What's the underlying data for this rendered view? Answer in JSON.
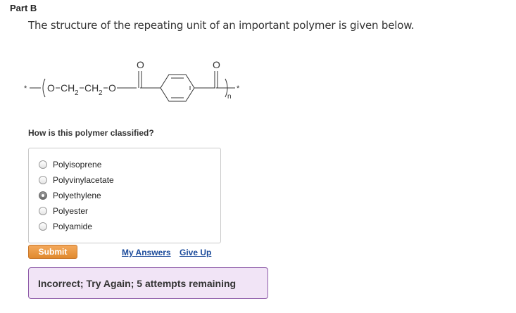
{
  "part": {
    "title": "Part B"
  },
  "intro": {
    "text": "The structure of the repeating unit of an important polymer is given below."
  },
  "structure": {
    "left_star": "*",
    "formula_o1": "O",
    "formula_ch2_1": "CH",
    "formula_sub_1": "2",
    "formula_ch2_2": "CH",
    "formula_sub_2": "2",
    "formula_o2": "O",
    "carbonyl_o_1": "O",
    "carbonyl_o_2": "O",
    "subscript_n": "n",
    "right_star": "*"
  },
  "question": {
    "text": "How is this polymer classified?"
  },
  "options": [
    {
      "label": "Polyisoprene",
      "selected": false
    },
    {
      "label": "Polyvinylacetate",
      "selected": false
    },
    {
      "label": "Polyethylene",
      "selected": true
    },
    {
      "label": "Polyester",
      "selected": false
    },
    {
      "label": "Polyamide",
      "selected": false
    }
  ],
  "actions": {
    "submit_label": "Submit",
    "my_answers_label": "My Answers",
    "give_up_label": "Give Up"
  },
  "feedback": {
    "text": "Incorrect; Try Again; 5 attempts remaining"
  },
  "colors": {
    "submit": "#e8963e",
    "link": "#1a4a9a",
    "feedback_bg": "#f1e4f6",
    "feedback_border": "#8d5aa8"
  }
}
